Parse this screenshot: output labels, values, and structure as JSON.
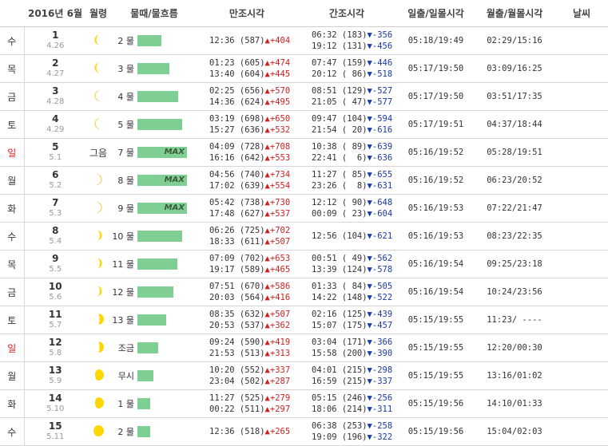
{
  "header": {
    "month": "2016년 6월",
    "moon": "월령",
    "tide": "물때/물흐름",
    "high": "만조시각",
    "low": "간조시각",
    "sun": "일출/일몰시각",
    "moontime": "월출/월몰시각",
    "weather": "날씨"
  },
  "colors": {
    "bar": "#7fcf95",
    "up": "#d22020",
    "down": "#1a3aa8",
    "sunday": "#e02020"
  },
  "rows": [
    {
      "dow": "수",
      "day": "1",
      "lunar": "4.26",
      "moon": "crescent-thin",
      "weather": "",
      "tide": "2 물",
      "bar": 0.48,
      "max": "",
      "high": [
        {
          "t": "12:36 (587)",
          "d": "▲+404"
        }
      ],
      "low": [
        {
          "t": "06:32 (183)",
          "d": "▼-356"
        },
        {
          "t": "19:12 (131)",
          "d": "▼-456"
        }
      ],
      "sun": "05:18/19:49",
      "moontime": "02:29/15:16"
    },
    {
      "dow": "목",
      "day": "2",
      "lunar": "4.27",
      "moon": "crescent-thin",
      "weather": "",
      "tide": "3 물",
      "bar": 0.65,
      "max": "",
      "high": [
        {
          "t": "01:23 (605)",
          "d": "▲+474"
        },
        {
          "t": "13:40 (604)",
          "d": "▲+445"
        }
      ],
      "low": [
        {
          "t": "07:47 (159)",
          "d": "▼-446"
        },
        {
          "t": "20:12 ( 86)",
          "d": "▼-518"
        }
      ],
      "sun": "05:17/19:50",
      "moontime": "03:09/16:25"
    },
    {
      "dow": "금",
      "day": "3",
      "lunar": "4.28",
      "moon": "crescent-faint",
      "weather": "",
      "tide": "4 물",
      "bar": 0.82,
      "max": "",
      "high": [
        {
          "t": "02:25 (656)",
          "d": "▲+570"
        },
        {
          "t": "14:36 (624)",
          "d": "▲+495"
        }
      ],
      "low": [
        {
          "t": "08:51 (129)",
          "d": "▼-527"
        },
        {
          "t": "21:05 ( 47)",
          "d": "▼-577"
        }
      ],
      "sun": "05:17/19:50",
      "moontime": "03:51/17:35"
    },
    {
      "dow": "토",
      "day": "4",
      "lunar": "4.29",
      "moon": "crescent-faint",
      "weather": "",
      "tide": "5 물",
      "bar": 0.9,
      "max": "",
      "high": [
        {
          "t": "03:19 (698)",
          "d": "▲+650"
        },
        {
          "t": "15:27 (636)",
          "d": "▲+532"
        }
      ],
      "low": [
        {
          "t": "09:47 (104)",
          "d": "▼-594"
        },
        {
          "t": "21:54 ( 20)",
          "d": "▼-616"
        }
      ],
      "sun": "05:17/19:51",
      "moontime": "04:37/18:44"
    },
    {
      "dow": "일",
      "day": "5",
      "lunar": "5.1",
      "moon": "",
      "weather": "그음",
      "tide": "7 물",
      "bar": 1.0,
      "max": "MAX",
      "high": [
        {
          "t": "04:09 (728)",
          "d": "▲+708"
        },
        {
          "t": "16:16 (642)",
          "d": "▲+553"
        }
      ],
      "low": [
        {
          "t": "10:38 ( 89)",
          "d": "▼-639"
        },
        {
          "t": "22:41 (  6)",
          "d": "▼-636"
        }
      ],
      "sun": "05:16/19:52",
      "moontime": "05:28/19:51"
    },
    {
      "dow": "월",
      "day": "6",
      "lunar": "5.2",
      "moon": "crescent-faint-r",
      "weather": "",
      "tide": "8 물",
      "bar": 1.0,
      "max": "MAX",
      "high": [
        {
          "t": "04:56 (740)",
          "d": "▲+734"
        },
        {
          "t": "17:02 (639)",
          "d": "▲+554"
        }
      ],
      "low": [
        {
          "t": "11:27 ( 85)",
          "d": "▼-655"
        },
        {
          "t": "23:26 (  8)",
          "d": "▼-631"
        }
      ],
      "sun": "05:16/19:52",
      "moontime": "06:23/20:52"
    },
    {
      "dow": "화",
      "day": "7",
      "lunar": "5.3",
      "moon": "crescent-faint-r",
      "weather": "",
      "tide": "9 물",
      "bar": 1.0,
      "max": "MAX",
      "high": [
        {
          "t": "05:42 (738)",
          "d": "▲+730"
        },
        {
          "t": "17:48 (627)",
          "d": "▲+537"
        }
      ],
      "low": [
        {
          "t": "12:12 ( 90)",
          "d": "▼-648"
        },
        {
          "t": "00:09 ( 23)",
          "d": "▼-604"
        }
      ],
      "sun": "05:16/19:53",
      "moontime": "07:22/21:47"
    },
    {
      "dow": "수",
      "day": "8",
      "lunar": "5.4",
      "moon": "crescent-r",
      "weather": "",
      "tide": "10 물",
      "bar": 0.9,
      "max": "",
      "high": [
        {
          "t": "06:26 (725)",
          "d": "▲+702"
        },
        {
          "t": "18:33 (611)",
          "d": "▲+507"
        }
      ],
      "low": [
        {
          "t": "12:56 (104)",
          "d": "▼-621"
        }
      ],
      "sun": "05:16/19:53",
      "moontime": "08:23/22:35"
    },
    {
      "dow": "목",
      "day": "9",
      "lunar": "5.5",
      "moon": "crescent-r",
      "weather": "",
      "tide": "11 물",
      "bar": 0.8,
      "max": "",
      "high": [
        {
          "t": "07:09 (702)",
          "d": "▲+653"
        },
        {
          "t": "19:17 (589)",
          "d": "▲+465"
        }
      ],
      "low": [
        {
          "t": "00:51 ( 49)",
          "d": "▼-562"
        },
        {
          "t": "13:39 (124)",
          "d": "▼-578"
        }
      ],
      "sun": "05:16/19:54",
      "moontime": "09:25/23:18"
    },
    {
      "dow": "금",
      "day": "10",
      "lunar": "5.6",
      "moon": "crescent-r",
      "weather": "",
      "tide": "12 물",
      "bar": 0.72,
      "max": "",
      "high": [
        {
          "t": "07:51 (670)",
          "d": "▲+586"
        },
        {
          "t": "20:03 (564)",
          "d": "▲+416"
        }
      ],
      "low": [
        {
          "t": "01:33 ( 84)",
          "d": "▼-505"
        },
        {
          "t": "14:22 (148)",
          "d": "▼-522"
        }
      ],
      "sun": "05:16/19:54",
      "moontime": "10:24/23:56"
    },
    {
      "dow": "토",
      "day": "11",
      "lunar": "5.7",
      "moon": "half-r",
      "weather": "",
      "tide": "13 물",
      "bar": 0.58,
      "max": "",
      "high": [
        {
          "t": "08:35 (632)",
          "d": "▲+507"
        },
        {
          "t": "20:53 (537)",
          "d": "▲+362"
        }
      ],
      "low": [
        {
          "t": "02:16 (125)",
          "d": "▼-439"
        },
        {
          "t": "15:07 (175)",
          "d": "▼-457"
        }
      ],
      "sun": "05:15/19:55",
      "moontime": "11:23/ ----"
    },
    {
      "dow": "일",
      "day": "12",
      "lunar": "5.8",
      "moon": "half-r",
      "weather": "",
      "tide": "조금",
      "bar": 0.42,
      "max": "",
      "high": [
        {
          "t": "09:24 (590)",
          "d": "▲+419"
        },
        {
          "t": "21:53 (513)",
          "d": "▲+313"
        }
      ],
      "low": [
        {
          "t": "03:04 (171)",
          "d": "▼-366"
        },
        {
          "t": "15:58 (200)",
          "d": "▼-390"
        }
      ],
      "sun": "05:15/19:55",
      "moontime": "12:20/00:30"
    },
    {
      "dow": "월",
      "day": "13",
      "lunar": "5.9",
      "moon": "gibbous",
      "weather": "",
      "tide": "무시",
      "bar": 0.33,
      "max": "",
      "high": [
        {
          "t": "10:20 (552)",
          "d": "▲+337"
        },
        {
          "t": "23:04 (502)",
          "d": "▲+287"
        }
      ],
      "low": [
        {
          "t": "04:01 (215)",
          "d": "▼-298"
        },
        {
          "t": "16:59 (215)",
          "d": "▼-337"
        }
      ],
      "sun": "05:15/19:55",
      "moontime": "13:16/01:02"
    },
    {
      "dow": "화",
      "day": "14",
      "lunar": "5.10",
      "moon": "gibbous",
      "weather": "",
      "tide": "1 물",
      "bar": 0.25,
      "max": "",
      "high": [
        {
          "t": "11:27 (525)",
          "d": "▲+279"
        },
        {
          "t": "00:22 (511)",
          "d": "▲+297"
        }
      ],
      "low": [
        {
          "t": "05:15 (246)",
          "d": "▼-256"
        },
        {
          "t": "18:06 (214)",
          "d": "▼-311"
        }
      ],
      "sun": "05:15/19:56",
      "moontime": "14:10/01:33"
    },
    {
      "dow": "수",
      "day": "15",
      "lunar": "5.11",
      "moon": "gibbous-full",
      "weather": "",
      "tide": "2 물",
      "bar": 0.25,
      "max": "",
      "high": [
        {
          "t": "12:36 (518)",
          "d": "▲+265"
        }
      ],
      "low": [
        {
          "t": "06:38 (253)",
          "d": "▼-258"
        },
        {
          "t": "19:09 (196)",
          "d": "▼-322"
        }
      ],
      "sun": "05:15/19:56",
      "moontime": "15:04/02:03"
    }
  ]
}
